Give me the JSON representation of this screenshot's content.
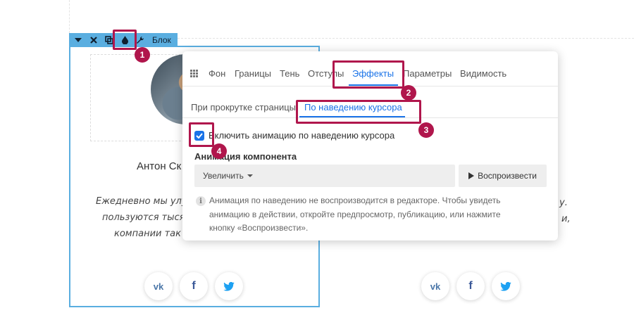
{
  "block_toolbar": {
    "label": "Блок",
    "icons": [
      "chevron-down-icon",
      "close-icon",
      "copy-icon",
      "drop-icon",
      "wrench-icon"
    ]
  },
  "card": {
    "name_partial": "Антон Ск",
    "quote_lines_left": [
      "Ежедневно мы улуч",
      "пользуются тыся",
      "компании так"
    ],
    "quote_lines_right": [
      "у.",
      "и,"
    ]
  },
  "social": {
    "icons": [
      "vk-icon",
      "facebook-icon",
      "twitter-icon"
    ],
    "vk_glyph": "vk",
    "fb_glyph": "f"
  },
  "panel": {
    "tabs": [
      "Фон",
      "Границы",
      "Тень",
      "Отступы",
      "Эффекты",
      "Параметры",
      "Видимость"
    ],
    "active_tab": "Эффекты",
    "subtabs": [
      "При прокрутке страницы",
      "По наведению курсора"
    ],
    "active_subtab": "По наведению курсора",
    "checkbox": {
      "label": "Включить анимацию по наведению курсора",
      "checked": true
    },
    "section_title": "Анимация компонента",
    "select_value": "Увеличить",
    "play_label": "Воспроизвести",
    "info_lines": [
      "Анимация по наведению не воспроизводится в редакторе. Чтобы увидеть",
      "анимацию в действии, откройте предпросмотр, публикацию, или нажмите",
      "кнопку «Воспроизвести»."
    ]
  },
  "annotations": [
    "1",
    "2",
    "3",
    "4"
  ],
  "colors": {
    "accent": "#1a73e8",
    "annotation": "#b0164c",
    "block_frame": "#5aaee0",
    "vk": "#4a76a8",
    "facebook": "#3b5998",
    "twitter": "#1da1f2"
  }
}
